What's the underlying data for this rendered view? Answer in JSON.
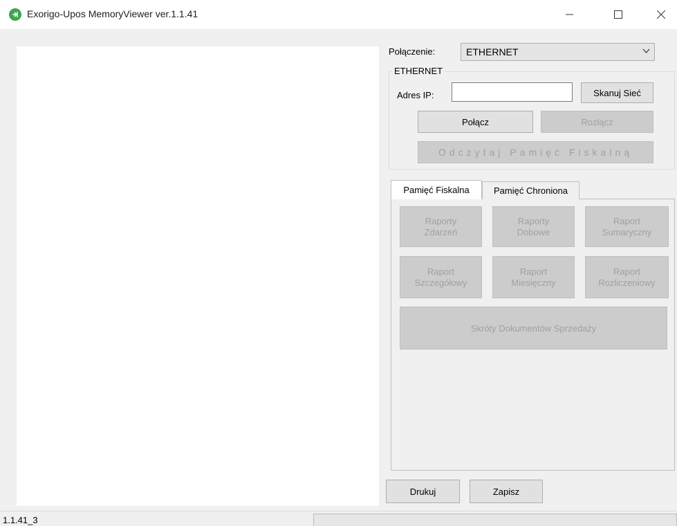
{
  "window": {
    "title": "Exorigo-Upos MemoryViewer ver.1.1.41",
    "icon": "exorigo-app-icon"
  },
  "connection": {
    "label": "Połączenie:",
    "selected": "ETHERNET"
  },
  "ethernet_group": {
    "title": "ETHERNET",
    "ip_label": "Adres IP:",
    "ip_value": "",
    "scan_label": "Skanuj Sieć",
    "connect_label": "Połącz",
    "disconnect_label": "Rozłącz",
    "read_label": "Odczytaj Pamięć Fiskalną"
  },
  "tabs": [
    {
      "label": "Pamięć Fiskalna",
      "active": true
    },
    {
      "label": "Pamięć Chroniona",
      "active": false
    }
  ],
  "fiscal_buttons": [
    {
      "line1": "Raporty",
      "line2": "Zdarzeń"
    },
    {
      "line1": "Raporty",
      "line2": "Dobowe"
    },
    {
      "line1": "Raport",
      "line2": "Sumaryczny"
    },
    {
      "line1": "Raport",
      "line2": "Szczegółowy"
    },
    {
      "line1": "Raport",
      "line2": "Miesięczny"
    },
    {
      "line1": "Raport",
      "line2": "Rozliczeniowy"
    }
  ],
  "sales_shortcuts_label": "Skróty Dokumentów Sprzedaży",
  "actions": {
    "print_label": "Drukuj",
    "save_label": "Zapisz"
  },
  "status": {
    "text": "1.1.41_3",
    "progress": 0
  },
  "colors": {
    "window_bg": "#f0f0f0",
    "disabled_text": "#a0a0a0",
    "app_icon": "#3aa64a"
  }
}
